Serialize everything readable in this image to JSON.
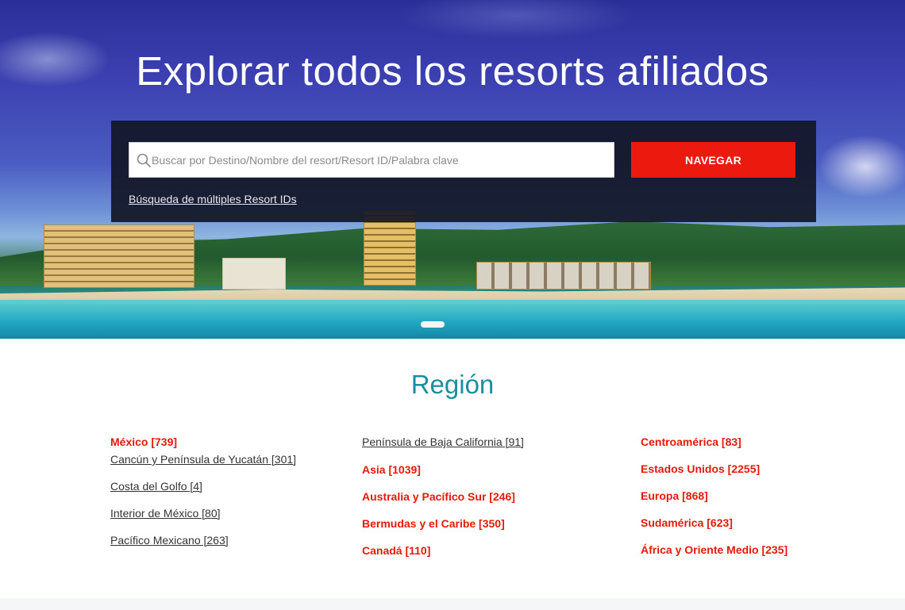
{
  "hero": {
    "title": "Explorar todos los resorts afiliados",
    "search_placeholder": "Buscar por Destino/Nombre del resort/Resort ID/Palabra clave",
    "search_value": "",
    "button_label": "NAVEGAR",
    "multi_search_link": "Búsqueda de múltiples Resort IDs"
  },
  "region": {
    "title": "Región",
    "columns": [
      [
        {
          "label": "México [739]",
          "style": "red"
        },
        {
          "label": "Cancún y Península de Yucatán [301]",
          "style": "sub"
        },
        {
          "label": "Costa del Golfo [4]",
          "style": "sub"
        },
        {
          "label": "Interior de México [80]",
          "style": "sub"
        },
        {
          "label": "Pacífico Mexicano [263]",
          "style": "sub"
        }
      ],
      [
        {
          "label": "Península de Baja California [91]",
          "style": "sub"
        },
        {
          "label": "Asia [1039]",
          "style": "red"
        },
        {
          "label": "Australia y Pacífico Sur [246]",
          "style": "red"
        },
        {
          "label": "Bermudas y el Caribe [350]",
          "style": "red"
        },
        {
          "label": "Canadá [110]",
          "style": "red"
        }
      ],
      [
        {
          "label": "Centroamérica [83]",
          "style": "red"
        },
        {
          "label": "Estados Unidos [2255]",
          "style": "red"
        },
        {
          "label": "Europa [868]",
          "style": "red"
        },
        {
          "label": "Sudamérica [623]",
          "style": "red"
        },
        {
          "label": "África y Oriente Medio [235]",
          "style": "red"
        }
      ]
    ]
  },
  "colors": {
    "accent_red": "#ec1a0e",
    "region_title": "#1b8fa0",
    "panel": "#12162699"
  },
  "icons": {
    "search": "search-icon"
  }
}
